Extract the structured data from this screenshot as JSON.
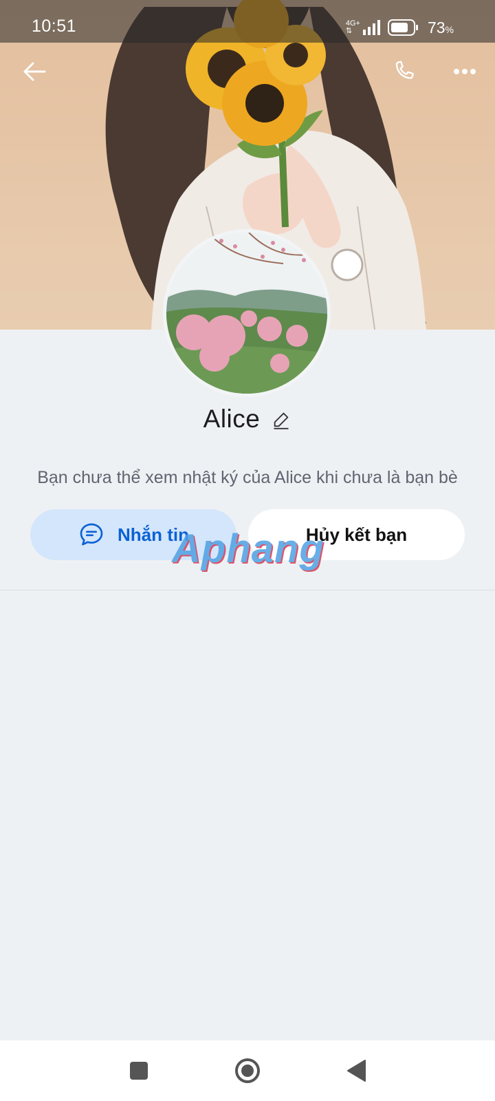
{
  "status_bar": {
    "time": "10:51",
    "network_top": "4G+",
    "network_bottom": "⇅",
    "battery_percent": "73",
    "battery_unit": "%"
  },
  "header": {
    "back_icon": "arrow-left-icon",
    "call_icon": "phone-icon",
    "more_icon": "more-horizontal-icon"
  },
  "profile": {
    "name": "Alice",
    "edit_icon": "pencil-icon",
    "notice": "Bạn chưa thể xem nhật ký của Alice khi chưa là bạn bè"
  },
  "actions": {
    "message_label": "Nhắn tin",
    "message_icon": "chat-bubble-icon",
    "unfriend_label": "Hủy kết bạn"
  },
  "watermark": "Aphang",
  "system_nav": {
    "recents_icon": "square-icon",
    "home_icon": "circle-icon",
    "back_icon": "triangle-back-icon"
  },
  "colors": {
    "accent": "#0a62d6",
    "message_bg": "#d4e6fb",
    "page_bg": "#eef1f4"
  }
}
